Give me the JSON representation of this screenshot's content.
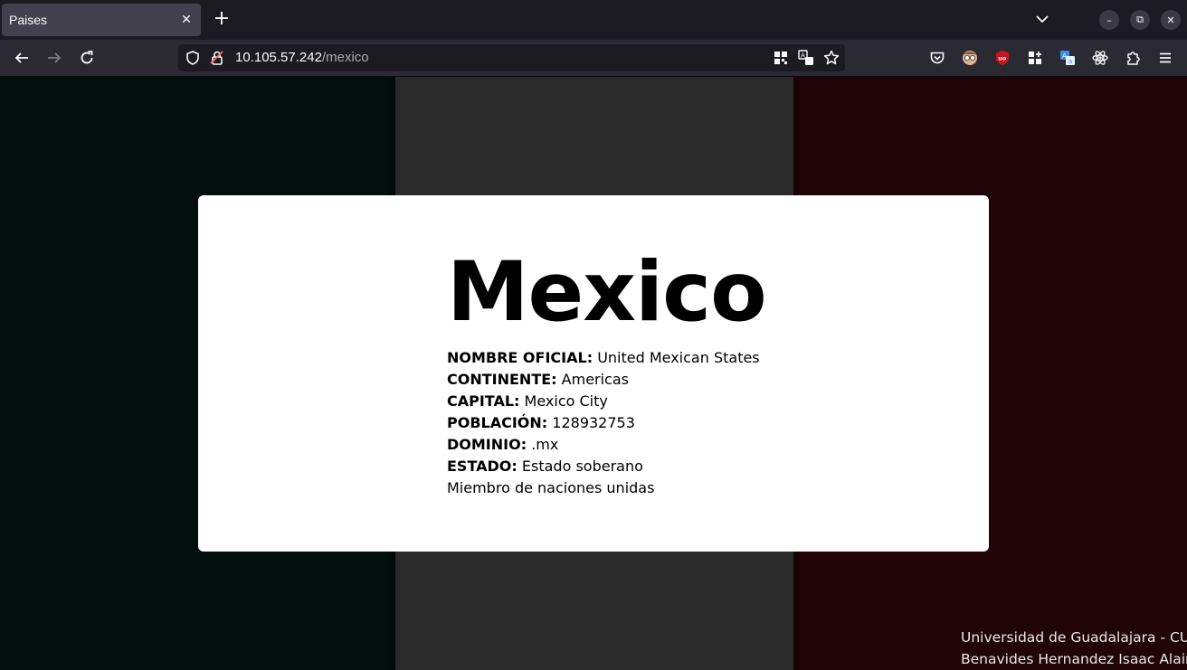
{
  "browser": {
    "tab_title": "Paises",
    "tab_close": "✕",
    "new_tab": "+",
    "url_host": "10.105.57.242",
    "url_path": "/mexico",
    "win_minimize": "–",
    "win_restore": "⧉",
    "win_close": "✕",
    "icons": [
      "back-arrow-icon",
      "forward-arrow-icon",
      "reload-icon",
      "shield-icon",
      "insecure-lock-icon",
      "qr-code-icon",
      "translate-icon",
      "bookmark-star-icon",
      "pocket-icon",
      "extension-avatar-icon",
      "ublock-icon",
      "extension-grid-icon",
      "translator-extension-icon",
      "react-devtools-icon",
      "extensions-puzzle-icon",
      "menu-icon"
    ]
  },
  "country": {
    "name": "Mexico",
    "fields": [
      {
        "label": "NOMBRE OFICIAL:",
        "value": "United Mexican States"
      },
      {
        "label": "CONTINENTE:",
        "value": "Americas"
      },
      {
        "label": "CAPITAL:",
        "value": "Mexico City"
      },
      {
        "label": "POBLACIÓN:",
        "value": "128932753"
      },
      {
        "label": "DOMINIO:",
        "value": ".mx"
      },
      {
        "label": "ESTADO:",
        "value": "Estado soberano"
      }
    ],
    "un_member": "Miembro de naciones unidas"
  },
  "footer": {
    "line1": "Universidad de Guadalajara - CUCEI",
    "line2": "Benavides Hernandez Isaac Alain"
  },
  "colors": {
    "flag_green": "#020f0c",
    "flag_white": "#2a2a2a",
    "flag_red": "#210407"
  }
}
